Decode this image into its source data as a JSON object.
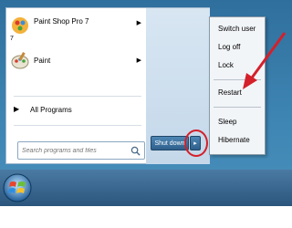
{
  "programs": [
    {
      "label": "Paint Shop Pro 7",
      "sub": "7",
      "icon": "paint-shop-pro-icon",
      "arrow": "▶"
    },
    {
      "label": "Paint",
      "icon": "paint-icon",
      "arrow": "▶"
    }
  ],
  "all_programs": {
    "label": "All Programs",
    "arrow": "▶"
  },
  "search": {
    "placeholder": "Search programs and files"
  },
  "shutdown": {
    "label": "Shut down",
    "arrow": "▸"
  },
  "power_menu": {
    "items": [
      "Switch user",
      "Log off",
      "Lock",
      "Restart",
      "Sleep",
      "Hibernate"
    ]
  },
  "colors": {
    "highlight_circle": "#d4202a",
    "pointer_arrow": "#d4202a",
    "taskbar": "#2b557c"
  }
}
